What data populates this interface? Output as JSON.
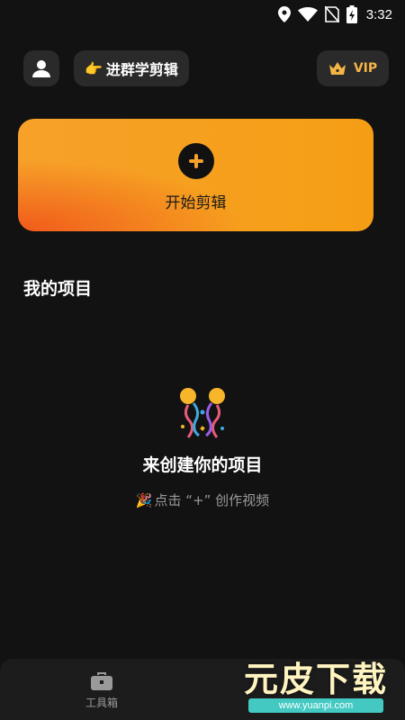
{
  "status_bar": {
    "time": "3:32",
    "icons": [
      "location-icon",
      "wifi-icon",
      "no-sim-icon",
      "battery-charging-icon"
    ]
  },
  "header": {
    "profile_icon": "user-icon",
    "group_button": {
      "emoji": "👉",
      "label": "进群学剪辑"
    },
    "vip_button": {
      "icon": "crown-icon",
      "label": "VIP",
      "color": "#f5b544"
    }
  },
  "start_card": {
    "icon": "plus-icon",
    "label": "开始剪辑",
    "gradient_colors": [
      "#f7a12a",
      "#f05a1a"
    ]
  },
  "projects": {
    "title": "我的项目",
    "empty_state": {
      "icon": "confetti-icon",
      "title": "来创建你的项目",
      "subtitle_emoji": "🎉",
      "subtitle": "点击 “+” 创作视频"
    }
  },
  "bottom_nav": {
    "tabs": [
      {
        "icon": "toolbox-icon",
        "label": "工具箱"
      }
    ]
  },
  "watermark": {
    "title": "元皮下载",
    "url": "www.yuanpi.com"
  }
}
